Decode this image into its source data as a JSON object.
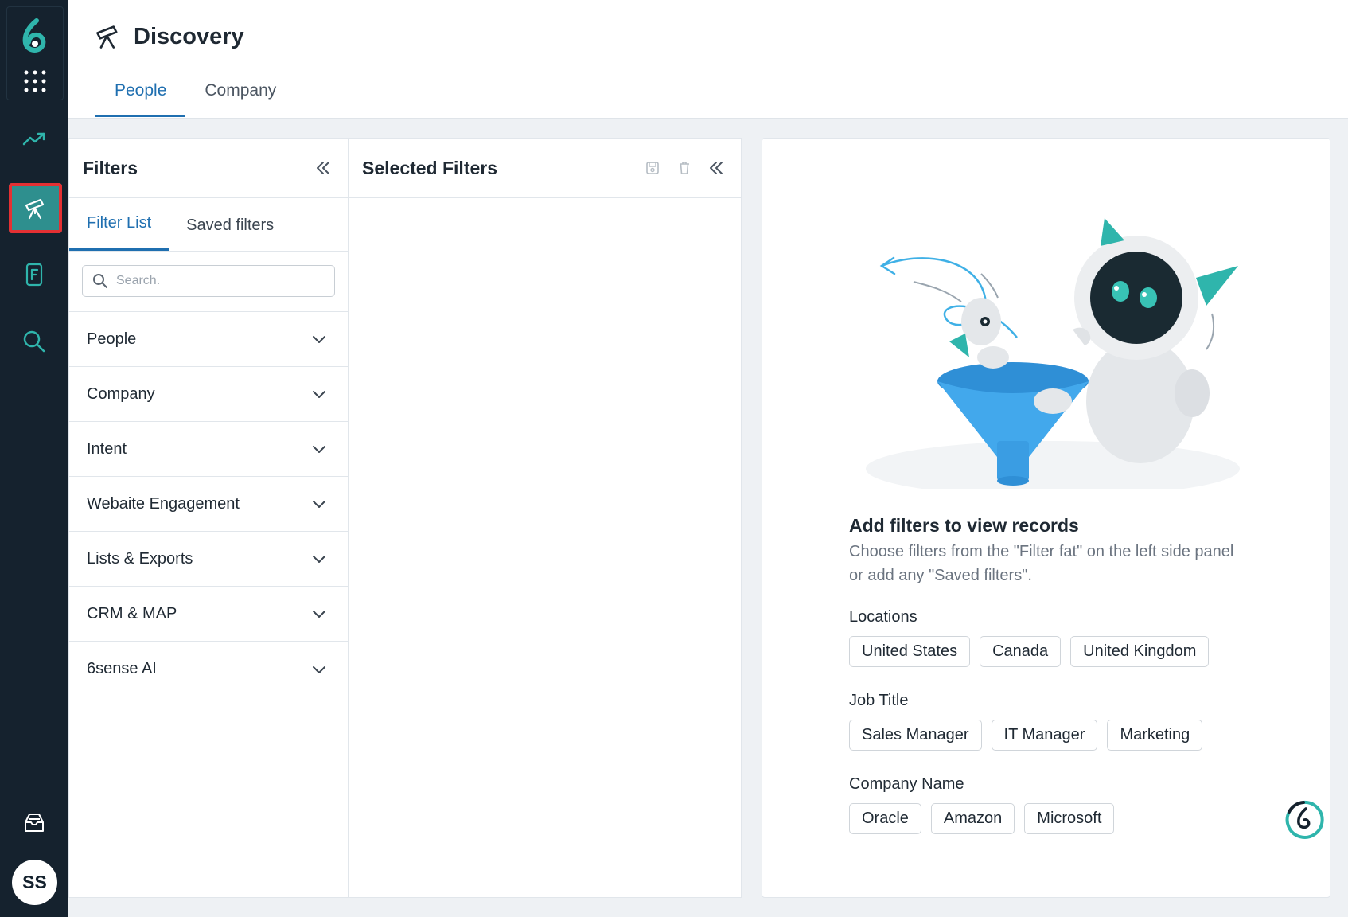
{
  "rail": {
    "avatar_initials": "SS",
    "items": [
      {
        "icon": "trend-line-icon"
      },
      {
        "icon": "telescope-icon",
        "active": true
      },
      {
        "icon": "form-icon"
      },
      {
        "icon": "search-icon"
      }
    ],
    "bottom_icon": "inbox-tray-icon"
  },
  "header": {
    "title": "Discovery",
    "tabs": [
      {
        "label": "People",
        "active": true
      },
      {
        "label": "Company",
        "active": false
      }
    ]
  },
  "filters": {
    "title": "Filters",
    "subtabs": [
      {
        "label": "Filter List",
        "active": true
      },
      {
        "label": "Saved filters",
        "active": false
      }
    ],
    "search_placeholder": "Search.",
    "categories": [
      "People",
      "Company",
      "Intent",
      "Webaite Engagement",
      "Lists & Exports",
      "CRM & MAP",
      "6sense AI"
    ]
  },
  "selected": {
    "title": "Selected Filters"
  },
  "empty_state": {
    "title": "Add filters to view records",
    "description": "Choose filters from the \"Filter fat\" on the left side panel or add any \"Saved filters\".",
    "groups": [
      {
        "label": "Locations",
        "chips": [
          "United States",
          "Canada",
          "United Kingdom"
        ]
      },
      {
        "label": "Job Title",
        "chips": [
          "Sales Manager",
          "IT Manager",
          "Marketing"
        ]
      },
      {
        "label": "Company Name",
        "chips": [
          "Oracle",
          "Amazon",
          "Microsoft"
        ]
      }
    ]
  },
  "colors": {
    "rail_bg": "#15222e",
    "accent_blue": "#1f6fb0",
    "teal": "#2e8f8e",
    "active_outline": "#e43033",
    "funnel_blue": "#3fa3e3"
  }
}
